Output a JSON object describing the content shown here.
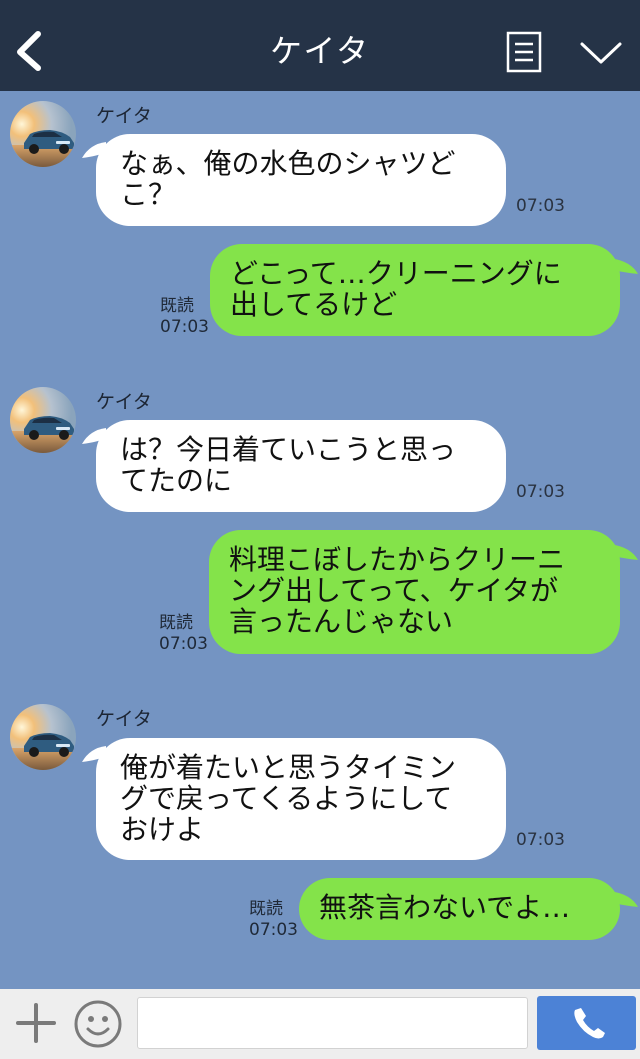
{
  "header": {
    "title": "ケイタ"
  },
  "colors": {
    "background": "#7494c2",
    "header": "#253347",
    "outgoing_bubble": "#84e34a",
    "incoming_bubble": "#ffffff",
    "send_button": "#4c82d6"
  },
  "messages": [
    {
      "direction": "incoming",
      "sender": "ケイタ",
      "text": "なぁ、俺の水色のシャツど\nこ？",
      "time": "07:03"
    },
    {
      "direction": "outgoing",
      "text": "どこって…クリーニングに\n出してるけど",
      "read": "既読",
      "time": "07:03"
    },
    {
      "direction": "incoming",
      "sender": "ケイタ",
      "text": "は？今日着ていこうと思っ\nてたのに",
      "time": "07:03"
    },
    {
      "direction": "outgoing",
      "text": "料理こぼしたからクリーニ\nング出してって、ケイタが\n言ったんじゃない",
      "read": "既読",
      "time": "07:03"
    },
    {
      "direction": "incoming",
      "sender": "ケイタ",
      "text": "俺が着たいと思うタイミン\nグで戻ってくるようにして\nおけよ",
      "time": "07:03"
    },
    {
      "direction": "outgoing",
      "text": "無茶言わないでよ…",
      "read": "既読",
      "time": "07:03"
    }
  ],
  "input": {
    "placeholder": "",
    "value": ""
  },
  "icons": {
    "back": "chevron-left-icon",
    "memo": "note-list-icon",
    "menu": "chevron-down-icon",
    "add": "plus-icon",
    "emoji": "smiley-icon",
    "call": "phone-icon"
  }
}
